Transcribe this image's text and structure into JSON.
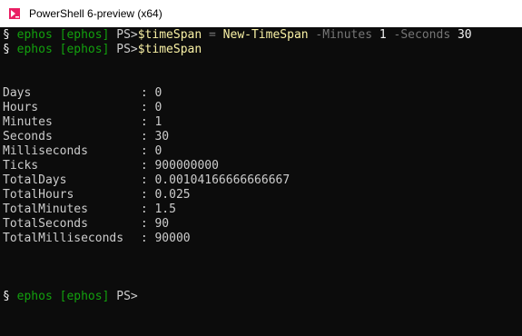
{
  "window": {
    "title": "PowerShell 6-preview (x64)",
    "icon": "powershell-icon"
  },
  "colors": {
    "background": "#0c0c0c",
    "prompt_green": "#13a10e",
    "parameter_gray": "#767676",
    "variable_yellow": "#f9f1a5",
    "text": "#cccccc"
  },
  "prompt": {
    "symbol": "§",
    "user": "ephos",
    "host": "[ephos]",
    "ps": "PS>"
  },
  "command1": {
    "variable": "$timeSpan",
    "operator": " = ",
    "cmdlet": "New-TimeSpan",
    "param1": "-Minutes",
    "value1": "1",
    "param2": "-Seconds",
    "value2": "30"
  },
  "command2": {
    "variable": "$timeSpan"
  },
  "separator": " : ",
  "output": [
    {
      "name": "Days",
      "value": "0"
    },
    {
      "name": "Hours",
      "value": "0"
    },
    {
      "name": "Minutes",
      "value": "1"
    },
    {
      "name": "Seconds",
      "value": "30"
    },
    {
      "name": "Milliseconds",
      "value": "0"
    },
    {
      "name": "Ticks",
      "value": "900000000"
    },
    {
      "name": "TotalDays",
      "value": "0.00104166666666667"
    },
    {
      "name": "TotalHours",
      "value": "0.025"
    },
    {
      "name": "TotalMinutes",
      "value": "1.5"
    },
    {
      "name": "TotalSeconds",
      "value": "90"
    },
    {
      "name": "TotalMilliseconds",
      "value": "90000"
    }
  ]
}
